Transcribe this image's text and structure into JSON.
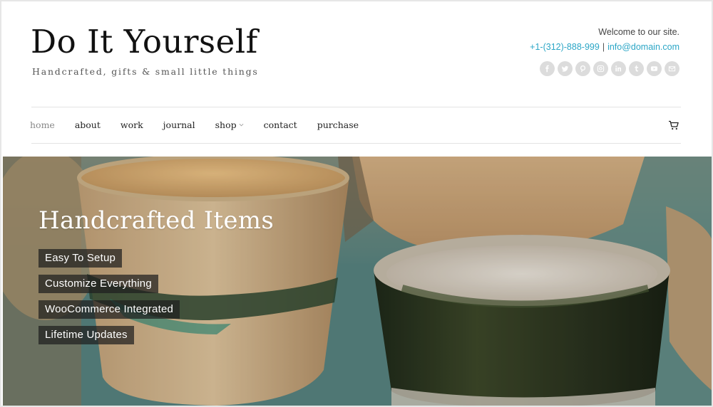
{
  "header": {
    "site_title": "Do It Yourself",
    "tagline": "Handcrafted, gifts & small little things",
    "welcome": "Welcome to our site.",
    "phone": "+1-(312)-888-999",
    "separator": "|",
    "email": "info@domain.com",
    "social": [
      "facebook-icon",
      "twitter-icon",
      "pinterest-icon",
      "instagram-icon",
      "linkedin-icon",
      "tumblr-icon",
      "youtube-icon",
      "email-icon"
    ]
  },
  "nav": {
    "items": [
      {
        "label": "home",
        "active": true
      },
      {
        "label": "about"
      },
      {
        "label": "work"
      },
      {
        "label": "journal"
      },
      {
        "label": "shop",
        "has_dropdown": true
      },
      {
        "label": "contact"
      },
      {
        "label": "purchase"
      }
    ],
    "cart_icon": "cart-icon"
  },
  "hero": {
    "title": "Handcrafted Items",
    "features": [
      "Easy To Setup",
      "Customize Everything",
      "WooCommerce Integrated",
      "Lifetime Updates"
    ]
  },
  "colors": {
    "accent": "#2ba6c6",
    "title": "#111111",
    "social_icon_bg": "#dcdcdc",
    "feature_bg": "#1e1e1e"
  }
}
